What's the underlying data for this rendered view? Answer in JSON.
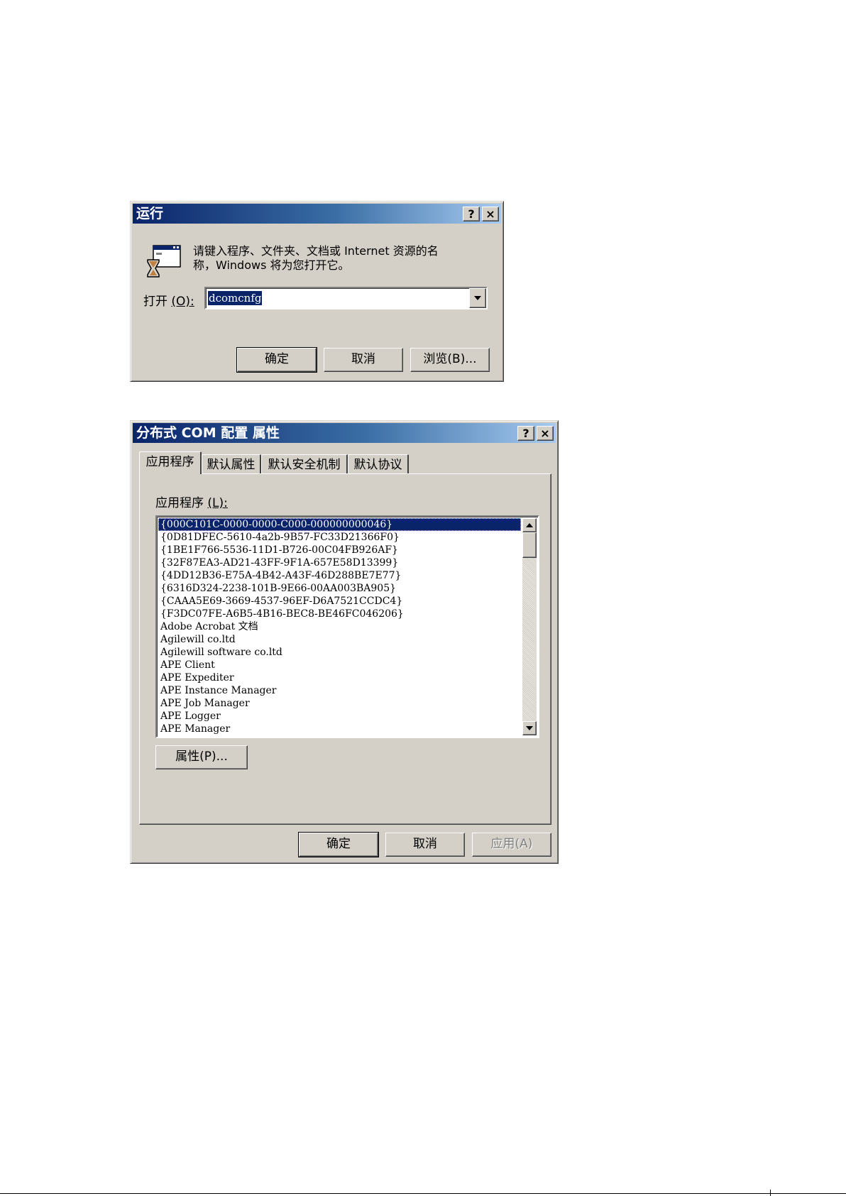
{
  "run_dialog": {
    "title": "运行",
    "help_btn": "?",
    "close_btn": "×",
    "prompt_line1": "请键入程序、文件夹、文档或 Internet 资源的名",
    "prompt_line2": "称，Windows 将为您打开它。",
    "open_label": "打开",
    "open_hotkey": "(O):",
    "open_value": "dcomcnfg",
    "ok": "确定",
    "cancel": "取消",
    "browse": "浏览(B)..."
  },
  "dcom_dialog": {
    "title": "分布式 COM 配置 属性",
    "help_btn": "?",
    "close_btn": "×",
    "tabs": [
      "应用程序",
      "默认属性",
      "默认安全机制",
      "默认协议"
    ],
    "list_label": "应用程序",
    "list_hotkey": "(L):",
    "items": [
      "{000C101C-0000-0000-C000-000000000046}",
      "{0D81DFEC-5610-4a2b-9B57-FC33D21366F0}",
      "{1BE1F766-5536-11D1-B726-00C04FB926AF}",
      "{32F87EA3-AD21-43FF-9F1A-657E58D13399}",
      "{4DD12B36-E75A-4B42-A43F-46D288BE7E77}",
      "{6316D324-2238-101B-9E66-00AA003BA905}",
      "{CAAA5E69-3669-4537-96EF-D6A7521CCDC4}",
      "{F3DC07FE-A6B5-4B16-BEC8-BE46FC046206}",
      "Adobe Acrobat 文档",
      "Agilewill co.ltd",
      "Agilewill software co.ltd",
      "APE Client",
      "APE Expediter",
      "APE Instance Manager",
      "APE Job Manager",
      "APE Logger",
      "APE Manager"
    ],
    "selected_index": 0,
    "properties_btn": "属性(P)...",
    "ok": "确定",
    "cancel": "取消",
    "apply": "应用(A)"
  }
}
